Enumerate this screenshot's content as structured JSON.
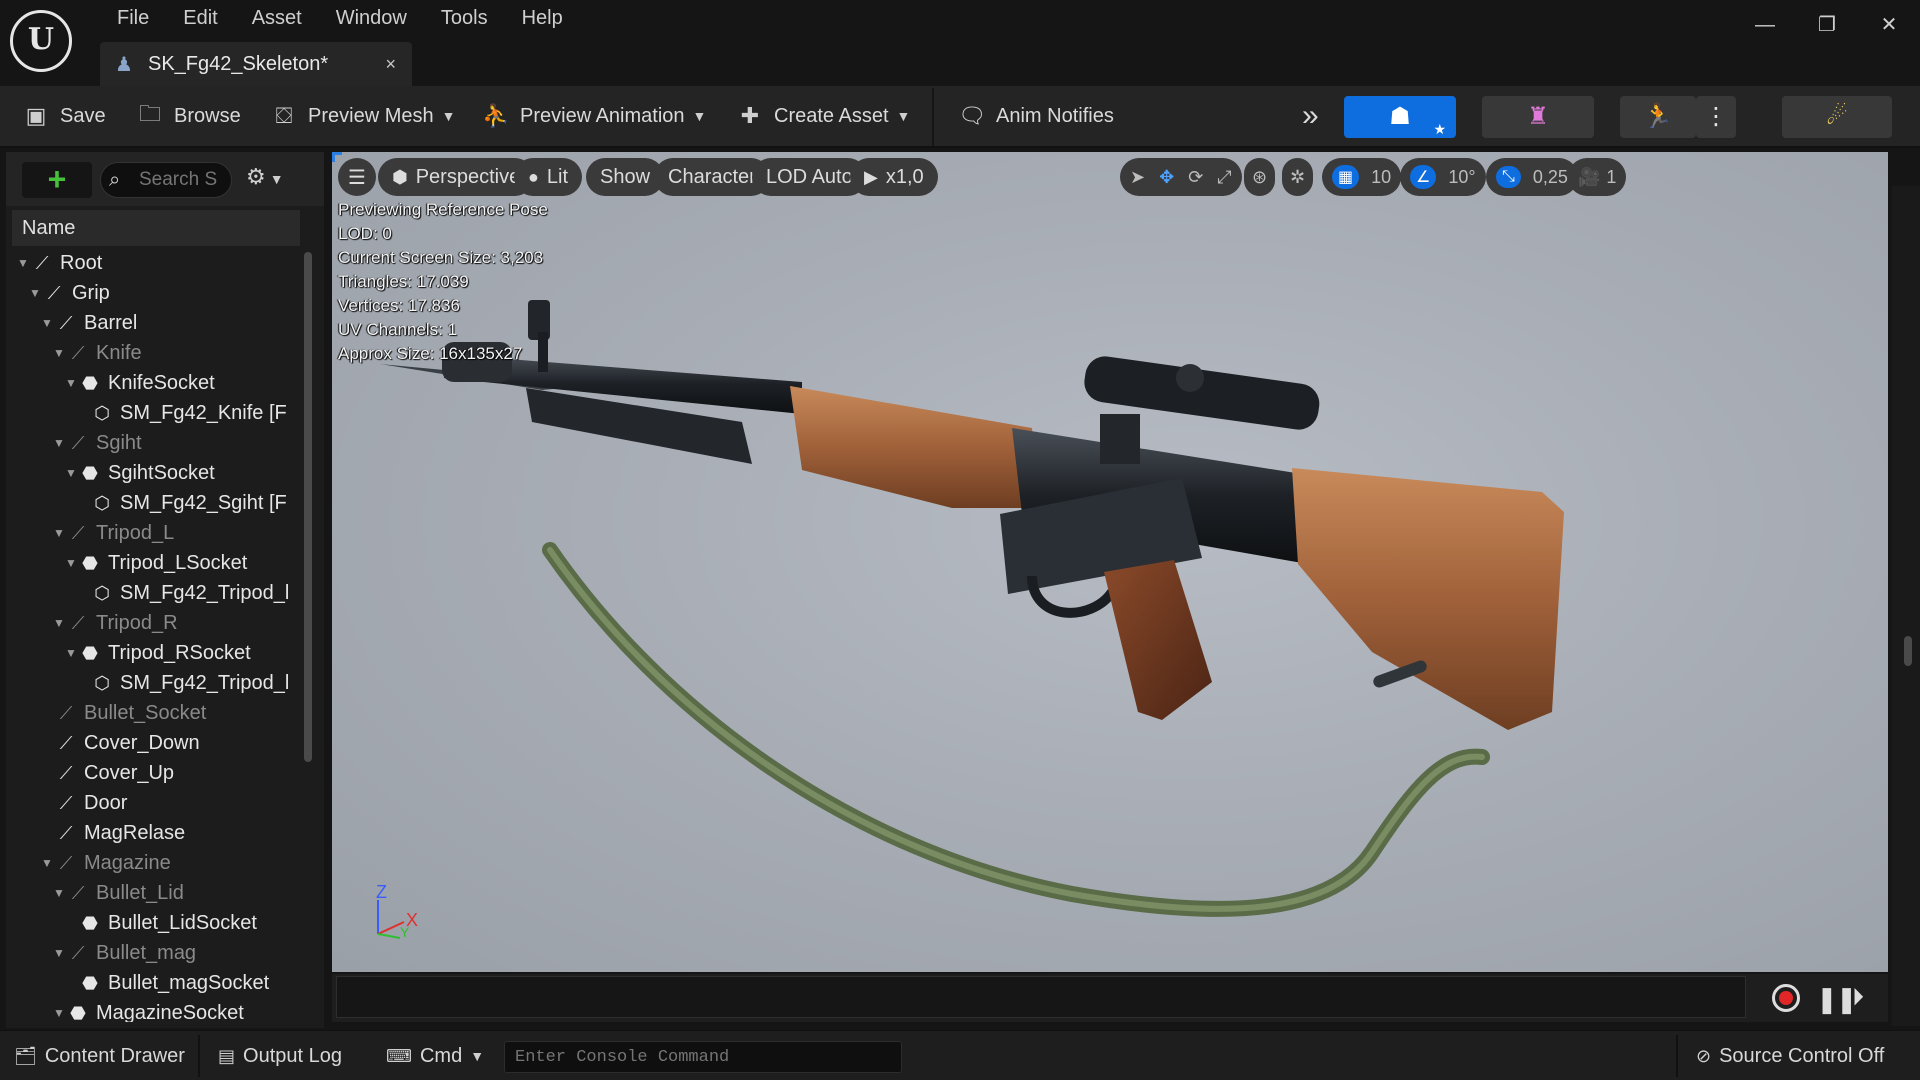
{
  "menubar": [
    "File",
    "Edit",
    "Asset",
    "Window",
    "Tools",
    "Help"
  ],
  "tab": {
    "label": "SK_Fg42_Skeleton*",
    "close": "×"
  },
  "window_controls": {
    "minimize": "—",
    "restore": "❐",
    "close": "✕"
  },
  "toolbar": {
    "save": "Save",
    "browse": "Browse",
    "preview_mesh": "Preview Mesh",
    "preview_animation": "Preview Animation",
    "create_asset": "Create Asset",
    "anim_notifies": "Anim Notifies",
    "overflow": "»"
  },
  "left_panel": {
    "search_placeholder": "Search S",
    "column_header": "Name",
    "tree": [
      {
        "label": "Root",
        "depth": 0,
        "type": "bone",
        "muted": false,
        "expanded": true
      },
      {
        "label": "Grip",
        "depth": 1,
        "type": "bone",
        "muted": false,
        "expanded": true
      },
      {
        "label": "Barrel",
        "depth": 2,
        "type": "bone",
        "muted": false,
        "expanded": true
      },
      {
        "label": "Knife",
        "depth": 3,
        "type": "bone",
        "muted": true,
        "expanded": true
      },
      {
        "label": "KnifeSocket",
        "depth": 4,
        "type": "socket",
        "muted": false,
        "expanded": true
      },
      {
        "label": "SM_Fg42_Knife [F",
        "depth": 5,
        "type": "mesh",
        "muted": false,
        "expanded": null
      },
      {
        "label": "Sgiht",
        "depth": 3,
        "type": "bone",
        "muted": true,
        "expanded": true
      },
      {
        "label": "SgihtSocket",
        "depth": 4,
        "type": "socket",
        "muted": false,
        "expanded": true
      },
      {
        "label": "SM_Fg42_Sgiht [F",
        "depth": 5,
        "type": "mesh",
        "muted": false,
        "expanded": null
      },
      {
        "label": "Tripod_L",
        "depth": 3,
        "type": "bone",
        "muted": true,
        "expanded": true
      },
      {
        "label": "Tripod_LSocket",
        "depth": 4,
        "type": "socket",
        "muted": false,
        "expanded": true
      },
      {
        "label": "SM_Fg42_Tripod_l",
        "depth": 5,
        "type": "mesh",
        "muted": false,
        "expanded": null
      },
      {
        "label": "Tripod_R",
        "depth": 3,
        "type": "bone",
        "muted": true,
        "expanded": true
      },
      {
        "label": "Tripod_RSocket",
        "depth": 4,
        "type": "socket",
        "muted": false,
        "expanded": true
      },
      {
        "label": "SM_Fg42_Tripod_l",
        "depth": 5,
        "type": "mesh",
        "muted": false,
        "expanded": null
      },
      {
        "label": "Bullet_Socket",
        "depth": 2,
        "type": "bone",
        "muted": true,
        "expanded": null
      },
      {
        "label": "Cover_Down",
        "depth": 2,
        "type": "bone",
        "muted": false,
        "expanded": null
      },
      {
        "label": "Cover_Up",
        "depth": 2,
        "type": "bone",
        "muted": false,
        "expanded": null
      },
      {
        "label": "Door",
        "depth": 2,
        "type": "bone",
        "muted": false,
        "expanded": null
      },
      {
        "label": "MagRelase",
        "depth": 2,
        "type": "bone",
        "muted": false,
        "expanded": null
      },
      {
        "label": "Magazine",
        "depth": 2,
        "type": "bone",
        "muted": true,
        "expanded": true
      },
      {
        "label": "Bullet_Lid",
        "depth": 3,
        "type": "bone",
        "muted": true,
        "expanded": true
      },
      {
        "label": "Bullet_LidSocket",
        "depth": 4,
        "type": "socket",
        "muted": false,
        "expanded": null
      },
      {
        "label": "Bullet_mag",
        "depth": 3,
        "type": "bone",
        "muted": true,
        "expanded": true
      },
      {
        "label": "Bullet_magSocket",
        "depth": 4,
        "type": "socket",
        "muted": false,
        "expanded": null
      },
      {
        "label": "MagazineSocket",
        "depth": 3,
        "type": "socket",
        "muted": false,
        "expanded": true
      }
    ]
  },
  "viewport": {
    "perspective": "Perspective",
    "lit": "Lit",
    "show": "Show",
    "character": "Character",
    "lod": "LOD Auto",
    "speed": "x1,0",
    "grid_snap": "10",
    "rotation_snap": "10°",
    "scale_snap": "0,25",
    "camera_speed": "1",
    "stats": [
      "Previewing Reference Pose",
      "LOD: 0",
      "Current Screen Size: 3,203",
      "Triangles: 17.039",
      "Vertices: 17.836",
      "UV Channels: 1",
      "Approx Size: 16x135x27"
    ],
    "axis": {
      "z": "Z",
      "x": "X",
      "y": "Y"
    }
  },
  "statusbar": {
    "content_drawer": "Content Drawer",
    "output_log": "Output Log",
    "cmd": "Cmd",
    "console_placeholder": "Enter Console Command",
    "source_control": "Source Control Off"
  },
  "colors": {
    "accent_blue": "#0e6ddf",
    "add_green": "#46c13a",
    "record_red": "#e02626",
    "viewport_bg": "#aab0b8"
  }
}
